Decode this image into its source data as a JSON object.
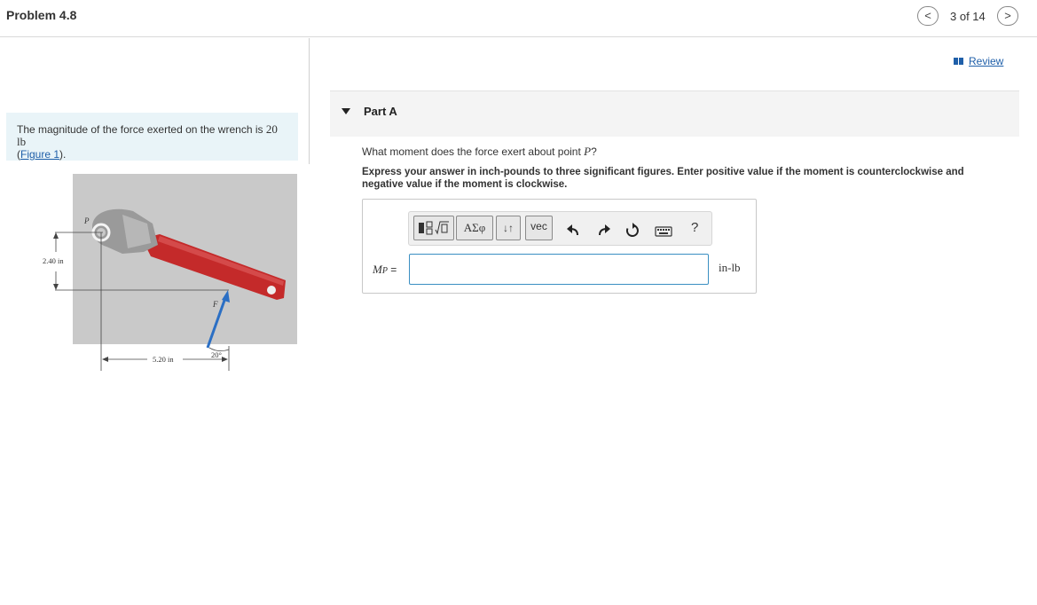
{
  "header": {
    "title": "Problem 4.8",
    "prev_icon": "<",
    "next_icon": ">",
    "pager": "3 of 14"
  },
  "review": {
    "label": "Review"
  },
  "problem": {
    "text_before": "The magnitude of the force exerted on the wrench is ",
    "magnitude": "20 lb",
    "link": "Figure 1",
    "link_open": "(",
    "link_close": ")."
  },
  "figure": {
    "point_label": "P",
    "force_label": "F",
    "vertical_dim": "2.40 in",
    "horizontal_dim": "5.20 in",
    "angle": "20°",
    "colors": {
      "handle": "#c42a2a",
      "background": "#c9c9c9",
      "force_arrow": "#2b6fc4"
    }
  },
  "part": {
    "label": "Part A",
    "question_before": "What moment does the force exert about point ",
    "question_var": "P",
    "question_after": "?",
    "instructions": "Express your answer in inch-pounds to three significant figures. Enter positive value if the moment is counterclockwise and negative value if the moment is clockwise."
  },
  "toolbar": {
    "greek": "ΑΣφ",
    "sort": "↓↑",
    "vec": "vec",
    "help": "?",
    "icons": [
      "templates-icon",
      "undo-icon",
      "redo-icon",
      "reset-icon",
      "keyboard-icon"
    ]
  },
  "answer": {
    "var_main": "M",
    "var_sub": "P",
    "equals": " =",
    "value": "",
    "unit": "in-lb"
  }
}
